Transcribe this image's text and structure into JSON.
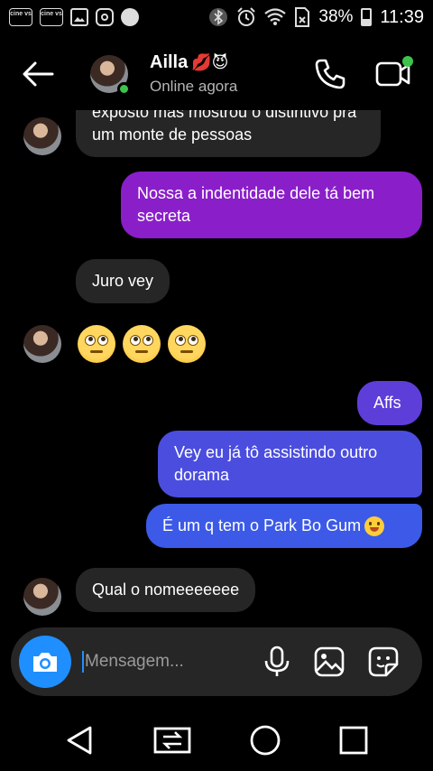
{
  "status_bar": {
    "app_icon_1": "cine vs",
    "app_icon_2": "cine vs",
    "battery": "38%",
    "time": "11:39",
    "icons": [
      "image-icon",
      "instagram-icon",
      "notification-icon",
      "bluetooth-icon",
      "alarm-icon",
      "wifi-icon",
      "no-sim-icon",
      "battery-icon"
    ]
  },
  "header": {
    "contact_name": "Ailla",
    "name_emojis": "💋😈",
    "status": "Online agora"
  },
  "messages": [
    {
      "type": "received",
      "text": "exposto mas mostrou o distintivo pra um monte de pessoas",
      "partial_visible": "pra um monte de pessoas"
    },
    {
      "type": "sent",
      "text": "Nossa a indentidade dele tá bem secreta"
    },
    {
      "type": "received",
      "text": "Juro vey"
    },
    {
      "type": "received_emoji",
      "text": "🙄🙄🙄"
    },
    {
      "type": "sent",
      "text": "Affs"
    },
    {
      "type": "sent",
      "text": "Vey eu já tô assistindo outro dorama"
    },
    {
      "type": "sent",
      "text": "É um q tem o Park Bo Gum"
    },
    {
      "type": "received",
      "text": "Qual o nomeeeeeee"
    }
  ],
  "composer": {
    "placeholder": "Mensagem..."
  },
  "colors": {
    "sent_gradient_top": "#8f1fc7",
    "sent_gradient_bottom": "#3a5be8",
    "received_bubble": "#262626",
    "accent_blue": "#1f8fff",
    "online_green": "#3ec34a"
  }
}
